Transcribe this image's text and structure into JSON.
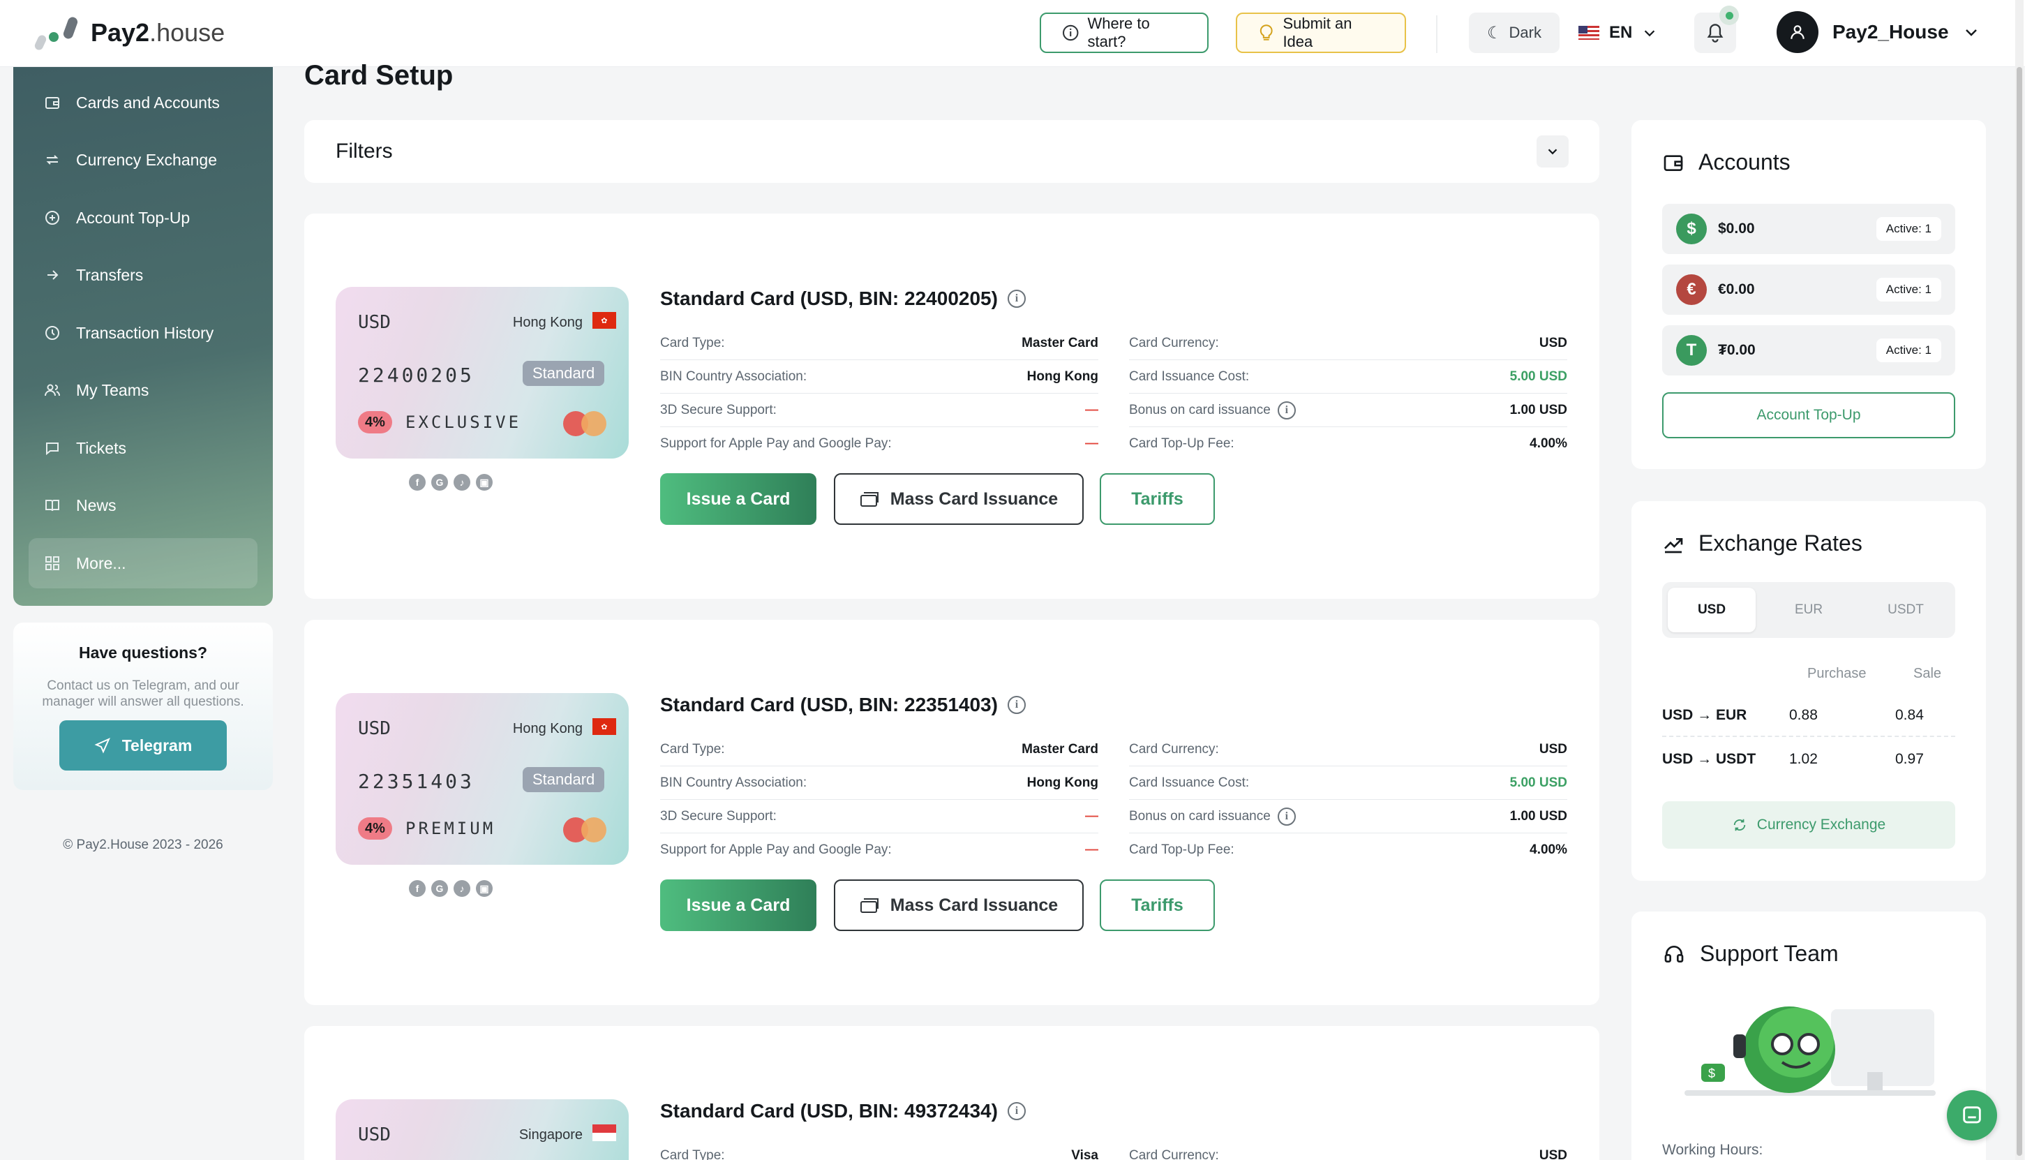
{
  "header": {
    "logo_bold": "Pay2",
    "logo_light": ".house",
    "where_to_start": "Where to start?",
    "submit_idea": "Submit an Idea",
    "theme": "Dark",
    "language": "EN",
    "username": "Pay2_House"
  },
  "sidebar": {
    "items": [
      {
        "label": "Cards and Accounts",
        "icon": "wallet-icon"
      },
      {
        "label": "Currency Exchange",
        "icon": "exchange-icon"
      },
      {
        "label": "Account Top-Up",
        "icon": "plus-circle-icon"
      },
      {
        "label": "Transfers",
        "icon": "arrow-right-icon"
      },
      {
        "label": "Transaction History",
        "icon": "clock-icon"
      },
      {
        "label": "My Teams",
        "icon": "users-icon"
      },
      {
        "label": "Tickets",
        "icon": "chat-icon"
      },
      {
        "label": "News",
        "icon": "book-icon"
      },
      {
        "label": "More...",
        "icon": "grid-icon"
      }
    ],
    "help_title": "Have questions?",
    "help_text": "Contact us on Telegram, and our manager will answer all questions.",
    "telegram": "Telegram",
    "copyright": "© Pay2.House 2023 - 2026"
  },
  "main": {
    "title": "Card Setup",
    "filters": "Filters",
    "labels": {
      "card_type": "Card Type:",
      "bin_country": "BIN Country Association:",
      "secure": "3D Secure Support:",
      "apple": "Support for Apple Pay and Google Pay:",
      "currency": "Card Currency:",
      "issuance": "Card Issuance Cost:",
      "bonus": "Bonus on card issuance",
      "topup_fee": "Card Top-Up Fee:"
    },
    "buttons": {
      "issue": "Issue a Card",
      "mass": "Mass Card Issuance",
      "tariffs": "Tariffs"
    },
    "cards": [
      {
        "title": "Standard Card (USD, BIN: 22400205)",
        "currency": "USD",
        "country": "Hong Kong",
        "bin": "22400205",
        "tier_badge": "Standard",
        "percent": "4%",
        "tier": "EXCLUSIVE",
        "card_type": "Master Card",
        "bin_country": "Hong Kong",
        "secure": "—",
        "apple": "—",
        "card_currency": "USD",
        "issuance": "5.00 USD",
        "bonus": "1.00 USD",
        "topup_fee": "4.00%"
      },
      {
        "title": "Standard Card (USD, BIN: 22351403)",
        "currency": "USD",
        "country": "Hong Kong",
        "bin": "22351403",
        "tier_badge": "Standard",
        "percent": "4%",
        "tier": "PREMIUM",
        "card_type": "Master Card",
        "bin_country": "Hong Kong",
        "secure": "—",
        "apple": "—",
        "card_currency": "USD",
        "issuance": "5.00 USD",
        "bonus": "1.00 USD",
        "topup_fee": "4.00%"
      },
      {
        "title": "Standard Card (USD, BIN: 49372434)",
        "currency": "USD",
        "country": "Singapore",
        "card_type": "Visa",
        "card_currency": "USD"
      }
    ]
  },
  "accounts": {
    "title": "Accounts",
    "rows": [
      {
        "amount": "$0.00",
        "active": "Active: 1",
        "symbol": "$",
        "color": "#3a9a5e"
      },
      {
        "amount": "€0.00",
        "active": "Active: 1",
        "symbol": "€",
        "color": "#b4473f"
      },
      {
        "amount": "₮0.00",
        "active": "Active: 1",
        "symbol": "T",
        "color": "#3a9a5e"
      }
    ],
    "topup": "Account Top-Up"
  },
  "rates": {
    "title": "Exchange Rates",
    "tabs": [
      "USD",
      "EUR",
      "USDT"
    ],
    "purchase": "Purchase",
    "sale": "Sale",
    "rows": [
      {
        "pair": "USD → EUR",
        "purchase": "0.88",
        "sale": "0.84"
      },
      {
        "pair": "USD → USDT",
        "purchase": "1.02",
        "sale": "0.97"
      }
    ],
    "button": "Currency Exchange"
  },
  "support": {
    "title": "Support Team",
    "hours": "Working Hours:"
  },
  "colors": {
    "accent": "#3c9a6c",
    "danger": "#e2453b"
  }
}
